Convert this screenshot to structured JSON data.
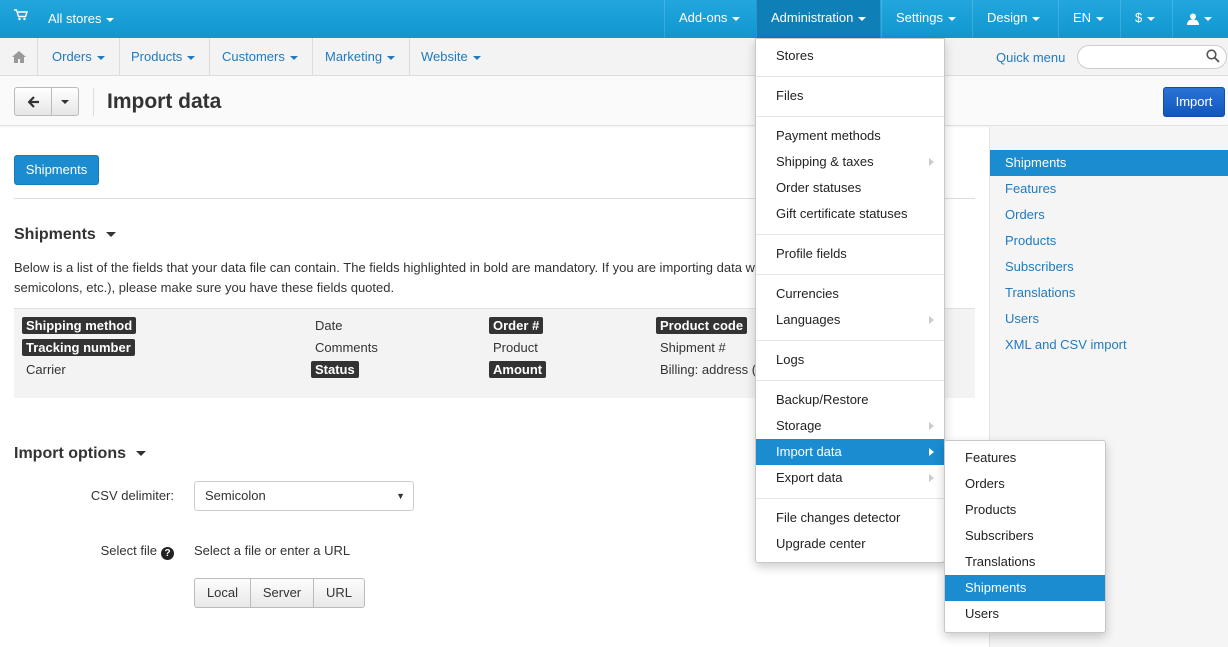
{
  "topbar": {
    "all_stores": "All stores",
    "nav": [
      "Add-ons",
      "Administration",
      "Settings",
      "Design",
      "EN",
      "$"
    ]
  },
  "secnav": {
    "items": [
      "Orders",
      "Products",
      "Customers",
      "Marketing",
      "Website"
    ],
    "quick_menu": "Quick menu",
    "search_placeholder": ""
  },
  "toolbar": {
    "title": "Import data",
    "import_label": "Import"
  },
  "sidebar": {
    "items": [
      "Shipments",
      "Features",
      "Orders",
      "Products",
      "Subscribers",
      "Translations",
      "Users",
      "XML and CSV import"
    ],
    "active": "Shipments"
  },
  "main": {
    "tab_button": "Shipments",
    "section_title": "Shipments",
    "description_line1": "Below is a list of the fields that your data file can contain. The fields highlighted in bold are mandatory. If you are importing data w",
    "description_line2": "semicolons, etc.), please make sure you have these fields quoted.",
    "fields": {
      "shipping_method": "Shipping method",
      "tracking_number": "Tracking number",
      "carrier": "Carrier",
      "date": "Date",
      "comments": "Comments",
      "status": "Status",
      "order_no": "Order #",
      "product": "Product",
      "amount": "Amount",
      "product_code": "Product code",
      "shipment_no": "Shipment #",
      "billing_address": "Billing: address ("
    },
    "import_options_title": "Import options",
    "csv_delimiter_label": "CSV delimiter:",
    "csv_delimiter_value": "Semicolon",
    "select_file_label": "Select file",
    "select_file_hint": "Select a file or enter a URL",
    "source_buttons": [
      "Local",
      "Server",
      "URL"
    ]
  },
  "admin_menu": {
    "items": [
      "Stores",
      "Files",
      "Payment methods",
      "Shipping & taxes",
      "Order statuses",
      "Gift certificate statuses",
      "Profile fields",
      "Currencies",
      "Languages",
      "Logs",
      "Backup/Restore",
      "Storage",
      "Import data",
      "Export data",
      "File changes detector",
      "Upgrade center"
    ],
    "active": "Import data"
  },
  "import_submenu": {
    "items": [
      "Features",
      "Orders",
      "Products",
      "Subscribers",
      "Translations",
      "Shipments",
      "Users"
    ],
    "active": "Shipments"
  },
  "colors": {
    "topbar": "#1aa0d7",
    "accent": "#1a8ccf",
    "link": "#1f7ac0",
    "primary_button": "#1357bd"
  }
}
